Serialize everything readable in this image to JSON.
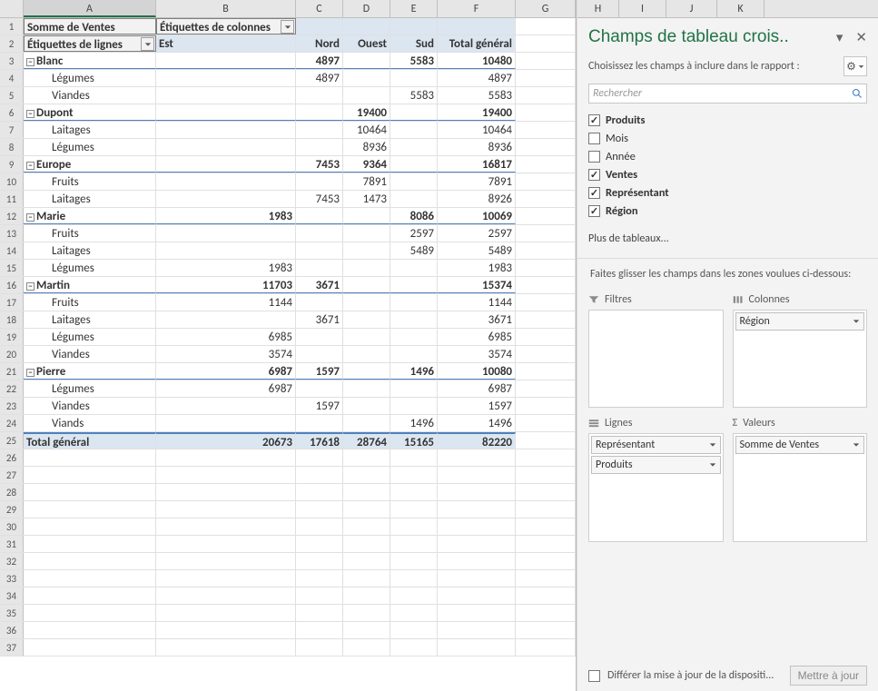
{
  "columns": [
    "A",
    "B",
    "C",
    "D",
    "E",
    "F",
    "G",
    "H",
    "I",
    "J",
    "K"
  ],
  "pivot": {
    "measure_label": "Somme de Ventes",
    "col_labels_title": "Étiquettes de colonnes",
    "row_labels_title": "Étiquettes de lignes",
    "col_headers": [
      "Est",
      "Nord",
      "Ouest",
      "Sud"
    ],
    "grand_total_col": "Total général",
    "grand_total_row": "Total général",
    "groups": [
      {
        "name": "Blanc",
        "est": "",
        "nord": "4897",
        "ouest": "",
        "sud": "5583",
        "tot": "10480",
        "items": [
          {
            "name": "Légumes",
            "nord": "4897",
            "tot": "4897"
          },
          {
            "name": "Viandes",
            "sud": "5583",
            "tot": "5583"
          }
        ]
      },
      {
        "name": "Dupont",
        "ouest": "19400",
        "tot": "19400",
        "items": [
          {
            "name": "Laitages",
            "ouest": "10464",
            "tot": "10464"
          },
          {
            "name": "Légumes",
            "ouest": "8936",
            "tot": "8936"
          }
        ]
      },
      {
        "name": "Europe",
        "nord": "7453",
        "ouest": "9364",
        "tot": "16817",
        "items": [
          {
            "name": "Fruits",
            "ouest": "7891",
            "tot": "7891"
          },
          {
            "name": "Laitages",
            "nord": "7453",
            "ouest": "1473",
            "tot": "8926"
          }
        ]
      },
      {
        "name": "Marie",
        "est": "1983",
        "sud": "8086",
        "tot": "10069",
        "items": [
          {
            "name": "Fruits",
            "sud": "2597",
            "tot": "2597"
          },
          {
            "name": "Laitages",
            "sud": "5489",
            "tot": "5489"
          },
          {
            "name": "Légumes",
            "est": "1983",
            "tot": "1983"
          }
        ]
      },
      {
        "name": "Martin",
        "est": "11703",
        "nord": "3671",
        "tot": "15374",
        "items": [
          {
            "name": "Fruits",
            "est": "1144",
            "tot": "1144"
          },
          {
            "name": "Laitages",
            "nord": "3671",
            "tot": "3671"
          },
          {
            "name": "Légumes",
            "est": "6985",
            "tot": "6985"
          },
          {
            "name": "Viandes",
            "est": "3574",
            "tot": "3574"
          }
        ]
      },
      {
        "name": "Pierre",
        "est": "6987",
        "nord": "1597",
        "sud": "1496",
        "tot": "10080",
        "items": [
          {
            "name": "Légumes",
            "est": "6987",
            "tot": "6987"
          },
          {
            "name": "Viandes",
            "nord": "1597",
            "tot": "1597"
          },
          {
            "name": "Viands",
            "sud": "1496",
            "tot": "1496"
          }
        ]
      }
    ],
    "grand_totals": {
      "est": "20673",
      "nord": "17618",
      "ouest": "28764",
      "sud": "15165",
      "tot": "82220"
    }
  },
  "pane": {
    "title": "Champs de tableau crois..",
    "subtitle": "Choisissez les champs à inclure dans le rapport :",
    "search_placeholder": "Rechercher",
    "fields": [
      {
        "label": "Produits",
        "checked": true
      },
      {
        "label": "Mois",
        "checked": false
      },
      {
        "label": "Année",
        "checked": false
      },
      {
        "label": "Ventes",
        "checked": true
      },
      {
        "label": "Représentant",
        "checked": true
      },
      {
        "label": "Région",
        "checked": true
      }
    ],
    "more_tables": "Plus de tableaux...",
    "drag_msg": "Faites glisser les champs dans les zones voulues ci-dessous:",
    "zones": {
      "filters": {
        "title": "Filtres",
        "items": []
      },
      "columns": {
        "title": "Colonnes",
        "items": [
          "Région"
        ]
      },
      "rows": {
        "title": "Lignes",
        "items": [
          "Représentant",
          "Produits"
        ]
      },
      "values": {
        "title": "Valeurs",
        "items": [
          "Somme de Ventes"
        ]
      }
    },
    "defer_label": "Différer la mise à jour de la dispositi...",
    "update_btn": "Mettre à jour"
  }
}
